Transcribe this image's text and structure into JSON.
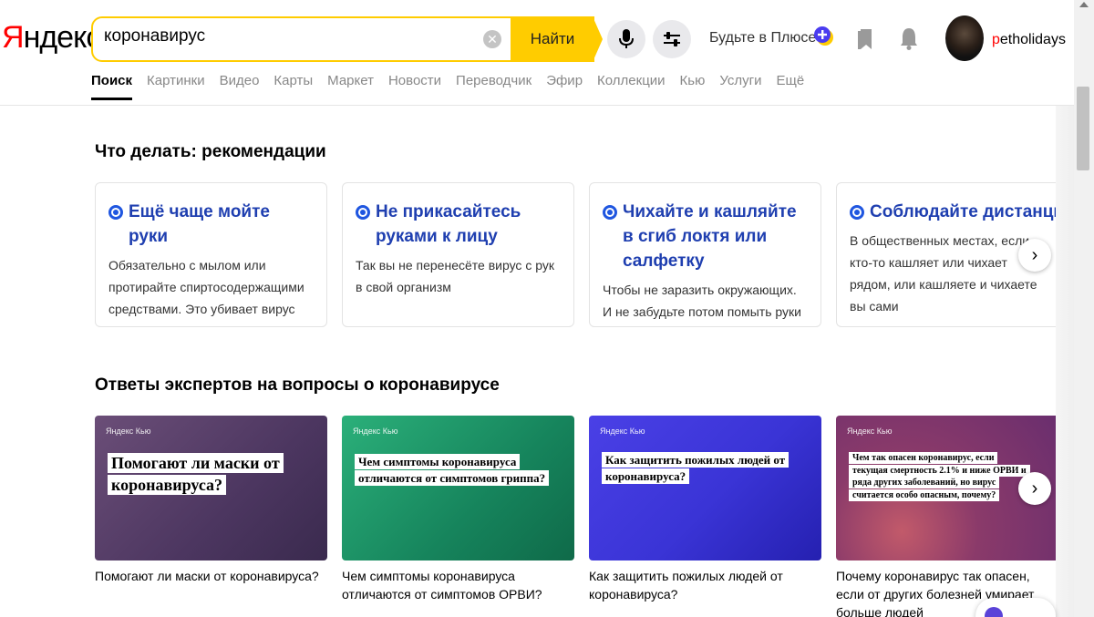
{
  "brand": {
    "logo_first": "Я",
    "logo_rest": "ндекс"
  },
  "search": {
    "query": "коронавирус",
    "find_label": "Найти"
  },
  "header": {
    "plus_label": "Будьте в Плюсе",
    "username_first": "p",
    "username_rest": "etholidays"
  },
  "tabs": [
    {
      "label": "Поиск",
      "active": true
    },
    {
      "label": "Картинки"
    },
    {
      "label": "Видео"
    },
    {
      "label": "Карты"
    },
    {
      "label": "Маркет"
    },
    {
      "label": "Новости"
    },
    {
      "label": "Переводчик"
    },
    {
      "label": "Эфир"
    },
    {
      "label": "Коллекции"
    },
    {
      "label": "Кью"
    },
    {
      "label": "Услуги"
    },
    {
      "label": "Ещё"
    }
  ],
  "recommendations": {
    "title": "Что делать: рекомендации",
    "cards": [
      {
        "title": "Ещё чаще мойте руки",
        "text": "Обязательно с мылом или протирайте спиртосодержащими средствами. Это убивает вирус"
      },
      {
        "title": "Не прикасайтесь руками к лицу",
        "text": "Так вы не перенесёте вирус с рук в свой организм"
      },
      {
        "title": "Чихайте и кашляйте в сгиб локтя или салфетку",
        "text": "Чтобы не заразить окружающих. И не забудьте потом помыть руки"
      },
      {
        "title": "Соблюдайте дистанцию",
        "text": "В общественных местах, если кто-то кашляет или чихает рядом, или кашляете и чихаете вы сами"
      }
    ]
  },
  "experts": {
    "title": "Ответы экспертов на вопросы о коронавирусе",
    "brand_label": "Яндекс Кью",
    "cards": [
      {
        "question": "Помогают ли маски от коронавируса?",
        "caption": "Помогают ли маски от коронавируса?",
        "color": "#5a3f6e"
      },
      {
        "question": "Чем симптомы коронавируса отличаются от симптомов гриппа?",
        "caption": "Чем симптомы коронавируса отличаются от симптомов ОРВИ?",
        "color": "#1b9a6a"
      },
      {
        "question": "Как защитить пожилых людей от коронавируса?",
        "caption": "Как защитить пожилых людей от коронавируса?",
        "color": "#3a34d6"
      },
      {
        "question": "Чем так опасен коронавирус, если текущая смертность 2.1% и ниже ОРВИ и ряда других заболеваний, но вирус считается особо опасным, почему?",
        "caption": "Почему коронавирус так опасен, если от других болезней умирает больше людей",
        "color": "#8a3a6a"
      }
    ]
  }
}
